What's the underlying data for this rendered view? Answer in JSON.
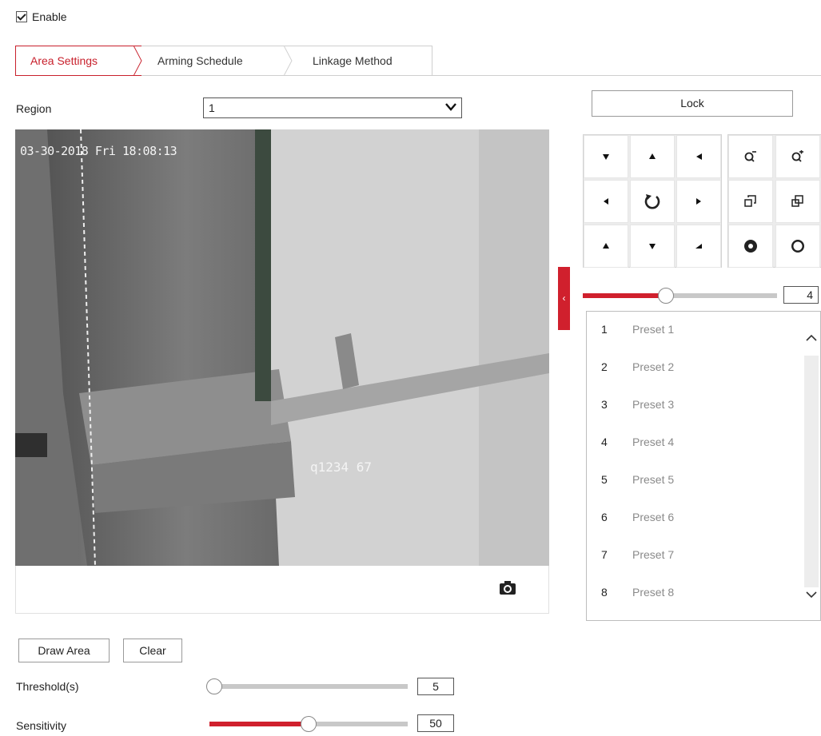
{
  "enable": {
    "label": "Enable",
    "checked": true
  },
  "tabs": [
    {
      "label": "Area Settings",
      "active": true
    },
    {
      "label": "Arming Schedule",
      "active": false
    },
    {
      "label": "Linkage Method",
      "active": false
    }
  ],
  "region": {
    "label": "Region",
    "value": "1"
  },
  "video": {
    "osd_timestamp": "03-30-2018 Fri 18:08:13",
    "osd_text": "q1234 67"
  },
  "buttons": {
    "draw_area": "Draw Area",
    "clear": "Clear",
    "lock": "Lock"
  },
  "threshold": {
    "label": "Threshold(s)",
    "value": "5",
    "fraction": 0.0
  },
  "sensitivity": {
    "label": "Sensitivity",
    "value": "50",
    "fraction": 0.5
  },
  "ptz": {
    "speed_value": "4",
    "speed_fraction": 0.43,
    "icons": [
      [
        "arrow-down-left-icon",
        "arrow-up-icon",
        "arrow-down-right-icon",
        "zoom-out-icon",
        "zoom-in-icon"
      ],
      [
        "arrow-left-icon",
        "auto-rotate-icon",
        "arrow-right-icon",
        "focus-near-icon",
        "focus-far-icon"
      ],
      [
        "arrow-up-left-icon",
        "arrow-down-icon",
        "arrow-up-right-icon",
        "iris-close-icon",
        "iris-open-icon"
      ]
    ]
  },
  "presets": [
    {
      "num": "1",
      "name": "Preset 1"
    },
    {
      "num": "2",
      "name": "Preset 2"
    },
    {
      "num": "3",
      "name": "Preset 3"
    },
    {
      "num": "4",
      "name": "Preset 4"
    },
    {
      "num": "5",
      "name": "Preset 5"
    },
    {
      "num": "6",
      "name": "Preset 6"
    },
    {
      "num": "7",
      "name": "Preset 7"
    },
    {
      "num": "8",
      "name": "Preset 8"
    }
  ],
  "colors": {
    "accent": "#d0202d",
    "track": "#c8c8c8"
  }
}
